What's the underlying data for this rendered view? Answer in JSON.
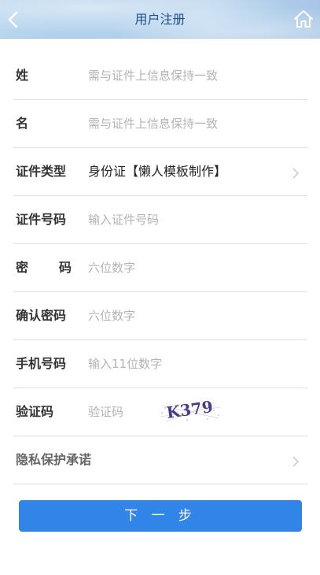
{
  "header": {
    "title": "用户注册",
    "back_icon": "chevron-left-icon",
    "home_icon": "home-icon"
  },
  "form": {
    "surname": {
      "label": "姓",
      "placeholder": "需与证件上信息保持一致"
    },
    "given_name": {
      "label": "名",
      "placeholder": "需与证件上信息保持一致"
    },
    "id_type": {
      "label": "证件类型",
      "value": "身份证【懒人模板制作】"
    },
    "id_number": {
      "label": "证件号码",
      "placeholder": "输入证件号码"
    },
    "password": {
      "label_left": "密",
      "label_right": "码",
      "placeholder": "六位数字"
    },
    "confirm_password": {
      "label": "确认密码",
      "placeholder": "六位数字"
    },
    "phone": {
      "label": "手机号码",
      "placeholder": "输入11位数字"
    },
    "captcha": {
      "label": "验证码",
      "placeholder": "验证码",
      "captcha_text": "K379"
    },
    "privacy": {
      "label": "隐私保护承诺"
    }
  },
  "next_button": {
    "label": "下 一 步"
  },
  "colors": {
    "accent": "#3285e8",
    "header_title": "#1f4e8f"
  }
}
